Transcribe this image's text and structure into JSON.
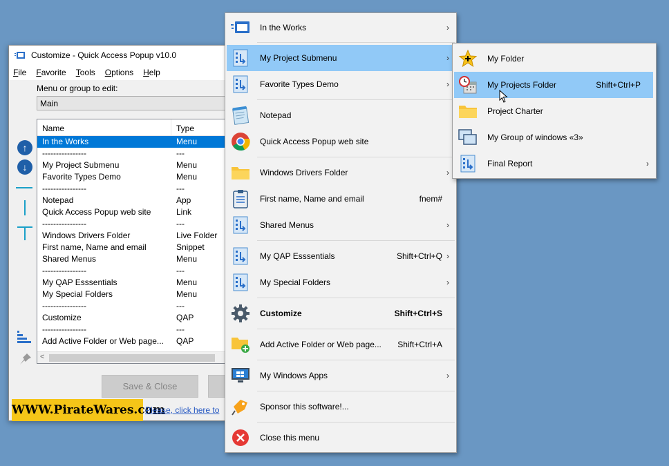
{
  "window": {
    "title": "Customize - Quick Access Popup v10.0",
    "menubar": [
      "File",
      "Favorite",
      "Tools",
      "Options",
      "Help"
    ],
    "menu_label": "Menu or group to edit:",
    "menu_value": "Main",
    "columns": [
      "Name",
      "Type"
    ],
    "rows": [
      {
        "name": "In the Works",
        "type": "Menu"
      },
      {
        "name": "----------------",
        "type": "---"
      },
      {
        "name": "My Project Submenu",
        "type": "Menu"
      },
      {
        "name": "Favorite Types Demo",
        "type": "Menu"
      },
      {
        "name": "----------------",
        "type": "---"
      },
      {
        "name": "Notepad",
        "type": "App"
      },
      {
        "name": "Quick Access Popup web site",
        "type": "Link"
      },
      {
        "name": "----------------",
        "type": "---"
      },
      {
        "name": "Windows Drivers Folder",
        "type": "Live Folder"
      },
      {
        "name": "First name, Name and email",
        "type": "Snippet"
      },
      {
        "name": "Shared Menus",
        "type": "Menu"
      },
      {
        "name": "----------------",
        "type": "---"
      },
      {
        "name": "My QAP Esssentials",
        "type": "Menu"
      },
      {
        "name": "My Special Folders",
        "type": "Menu"
      },
      {
        "name": "----------------",
        "type": "---"
      },
      {
        "name": "Customize",
        "type": "QAP"
      },
      {
        "name": "----------------",
        "type": "---"
      },
      {
        "name": "Add Active Folder or Web page...",
        "type": "QAP"
      }
    ],
    "save_close": "Save & Close",
    "banner": "WWW.PirateWares.com",
    "link": "Please, click here to"
  },
  "main_menu": [
    {
      "label": "In the Works",
      "shortcut": "",
      "submenu": true,
      "icon": "window-icon"
    },
    {
      "label": "My Project Submenu",
      "shortcut": "",
      "submenu": true,
      "icon": "submenu-icon",
      "highlight": true
    },
    {
      "label": "Favorite Types Demo",
      "shortcut": "",
      "submenu": true,
      "icon": "submenu-icon"
    },
    {
      "label": "Notepad",
      "shortcut": "",
      "submenu": false,
      "icon": "notepad-icon"
    },
    {
      "label": "Quick Access Popup web site",
      "shortcut": "",
      "submenu": false,
      "icon": "chrome-icon"
    },
    {
      "label": "Windows Drivers Folder",
      "shortcut": "",
      "submenu": true,
      "icon": "folder-icon"
    },
    {
      "label": "First name, Name and email",
      "shortcut": "fnem#",
      "submenu": false,
      "icon": "clipboard-icon"
    },
    {
      "label": "Shared Menus",
      "shortcut": "",
      "submenu": true,
      "icon": "submenu-icon"
    },
    {
      "label": "My QAP Esssentials",
      "shortcut": "Shift+Ctrl+Q",
      "submenu": true,
      "icon": "submenu-icon"
    },
    {
      "label": "My Special Folders",
      "shortcut": "",
      "submenu": true,
      "icon": "submenu-icon"
    },
    {
      "label": "Customize",
      "shortcut": "Shift+Ctrl+S",
      "submenu": false,
      "icon": "gear-icon",
      "bold": true
    },
    {
      "label": "Add Active Folder or Web page...",
      "shortcut": "Shift+Ctrl+A",
      "submenu": false,
      "icon": "add-folder-icon"
    },
    {
      "label": "My Windows Apps",
      "shortcut": "",
      "submenu": true,
      "icon": "monitor-icon"
    },
    {
      "label": "Sponsor this software!...",
      "shortcut": "",
      "submenu": false,
      "icon": "sponsor-icon"
    },
    {
      "label": "Close this menu",
      "shortcut": "",
      "submenu": false,
      "icon": "close-icon"
    }
  ],
  "sub_menu": [
    {
      "label": "My Folder",
      "shortcut": "",
      "submenu": false,
      "icon": "star-icon"
    },
    {
      "label": "My Projects Folder",
      "shortcut": "Shift+Ctrl+P",
      "submenu": false,
      "icon": "calendar-clock-icon",
      "highlight": true
    },
    {
      "label": "Project Charter",
      "shortcut": "",
      "submenu": false,
      "icon": "folder-icon"
    },
    {
      "label": "My Group of windows «3»",
      "shortcut": "",
      "submenu": false,
      "icon": "windows-group-icon"
    },
    {
      "label": "Final Report",
      "shortcut": "",
      "submenu": true,
      "icon": "submenu-icon"
    }
  ],
  "colors": {
    "highlight": "#91c9f7",
    "selection": "#0078d7",
    "desktop": "#6a97c3"
  }
}
